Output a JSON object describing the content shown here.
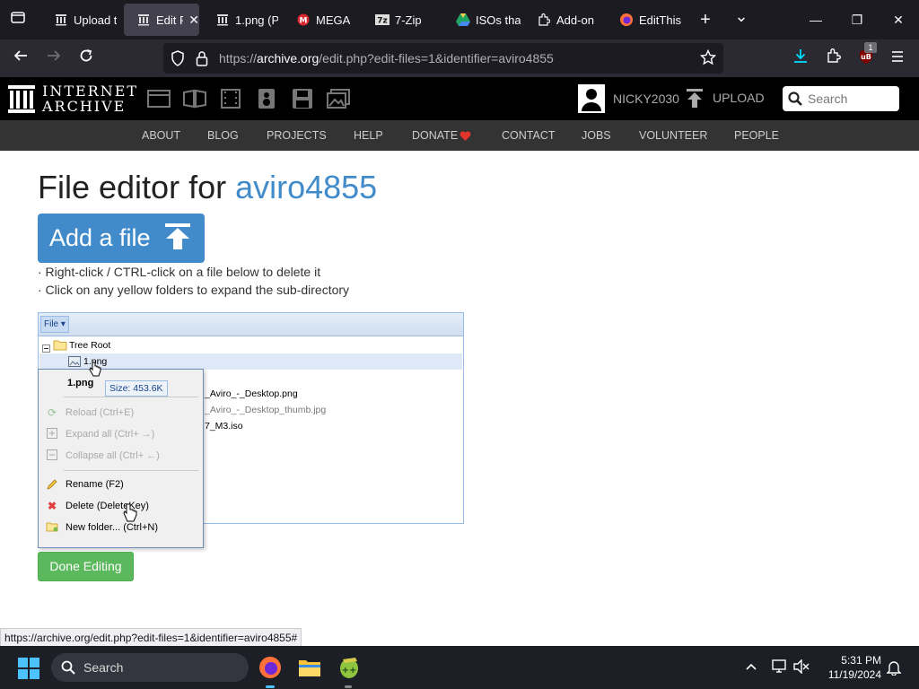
{
  "browser": {
    "tabs": [
      {
        "title": "Upload t",
        "active": false
      },
      {
        "title": "Edit F",
        "active": true
      },
      {
        "title": "1.png (P",
        "active": false
      },
      {
        "title": "MEGA",
        "active": false
      },
      {
        "title": "7-Zip",
        "active": false
      },
      {
        "title": "ISOs that",
        "active": false
      },
      {
        "title": "Add-on",
        "active": false
      },
      {
        "title": "EditThis",
        "active": false
      }
    ],
    "new_tab": "+",
    "tab_list": "⌄",
    "minimize": "—",
    "maximize": "❐",
    "close": "✕",
    "url_prefix": "https://",
    "url_host": "archive.org",
    "url_path": "/edit.php?edit-files=1&identifier=aviro4855",
    "extension_badge": "1"
  },
  "ia_header": {
    "logo_line1": "INTERNET",
    "logo_line2": "ARCHIVE",
    "username": "NICKY2030",
    "upload_label": "UPLOAD",
    "search_placeholder": "Search",
    "nav": [
      "ABOUT",
      "BLOG",
      "PROJECTS",
      "HELP",
      "DONATE",
      "CONTACT",
      "JOBS",
      "VOLUNTEER",
      "PEOPLE"
    ]
  },
  "page": {
    "title_prefix": "File editor for ",
    "identifier": "aviro4855",
    "add_file_label": "Add a file",
    "instruction_1": "· Right-click / CTRL-click on a file below to delete it",
    "instruction_2": "· Click on any yellow folders to expand the sub-directory",
    "done_label": "Done Editing"
  },
  "tree": {
    "file_menu": "File ▾",
    "root": "Tree Root",
    "selected_file": "1.png",
    "rows": [
      "_Aviro_-_Desktop.png",
      "_Aviro_-_Desktop_thumb.jpg",
      "7_M3.iso"
    ]
  },
  "context_menu": {
    "header": "1.png",
    "tooltip": "Size: 453.6K",
    "items": [
      {
        "label": "Reload (Ctrl+E)",
        "disabled": true
      },
      {
        "label": "Expand all (Ctrl+ →)",
        "disabled": true
      },
      {
        "label": "Collapse all (Ctrl+ ←)",
        "disabled": true
      },
      {
        "label": "Rename (F2)",
        "disabled": false
      },
      {
        "label": "Delete (DeleteKey)",
        "disabled": false
      },
      {
        "label": "New folder... (Ctrl+N)",
        "disabled": false
      }
    ]
  },
  "status_bar": {
    "url": "https://archive.org/edit.php?edit-files=1&identifier=aviro4855#"
  },
  "taskbar": {
    "search_label": "Search",
    "time": "5:31 PM",
    "date": "11/19/2024"
  },
  "colors": {
    "accent_blue": "#428bca",
    "done_green": "#5cb85c",
    "donate_heart": "#e2342b"
  }
}
